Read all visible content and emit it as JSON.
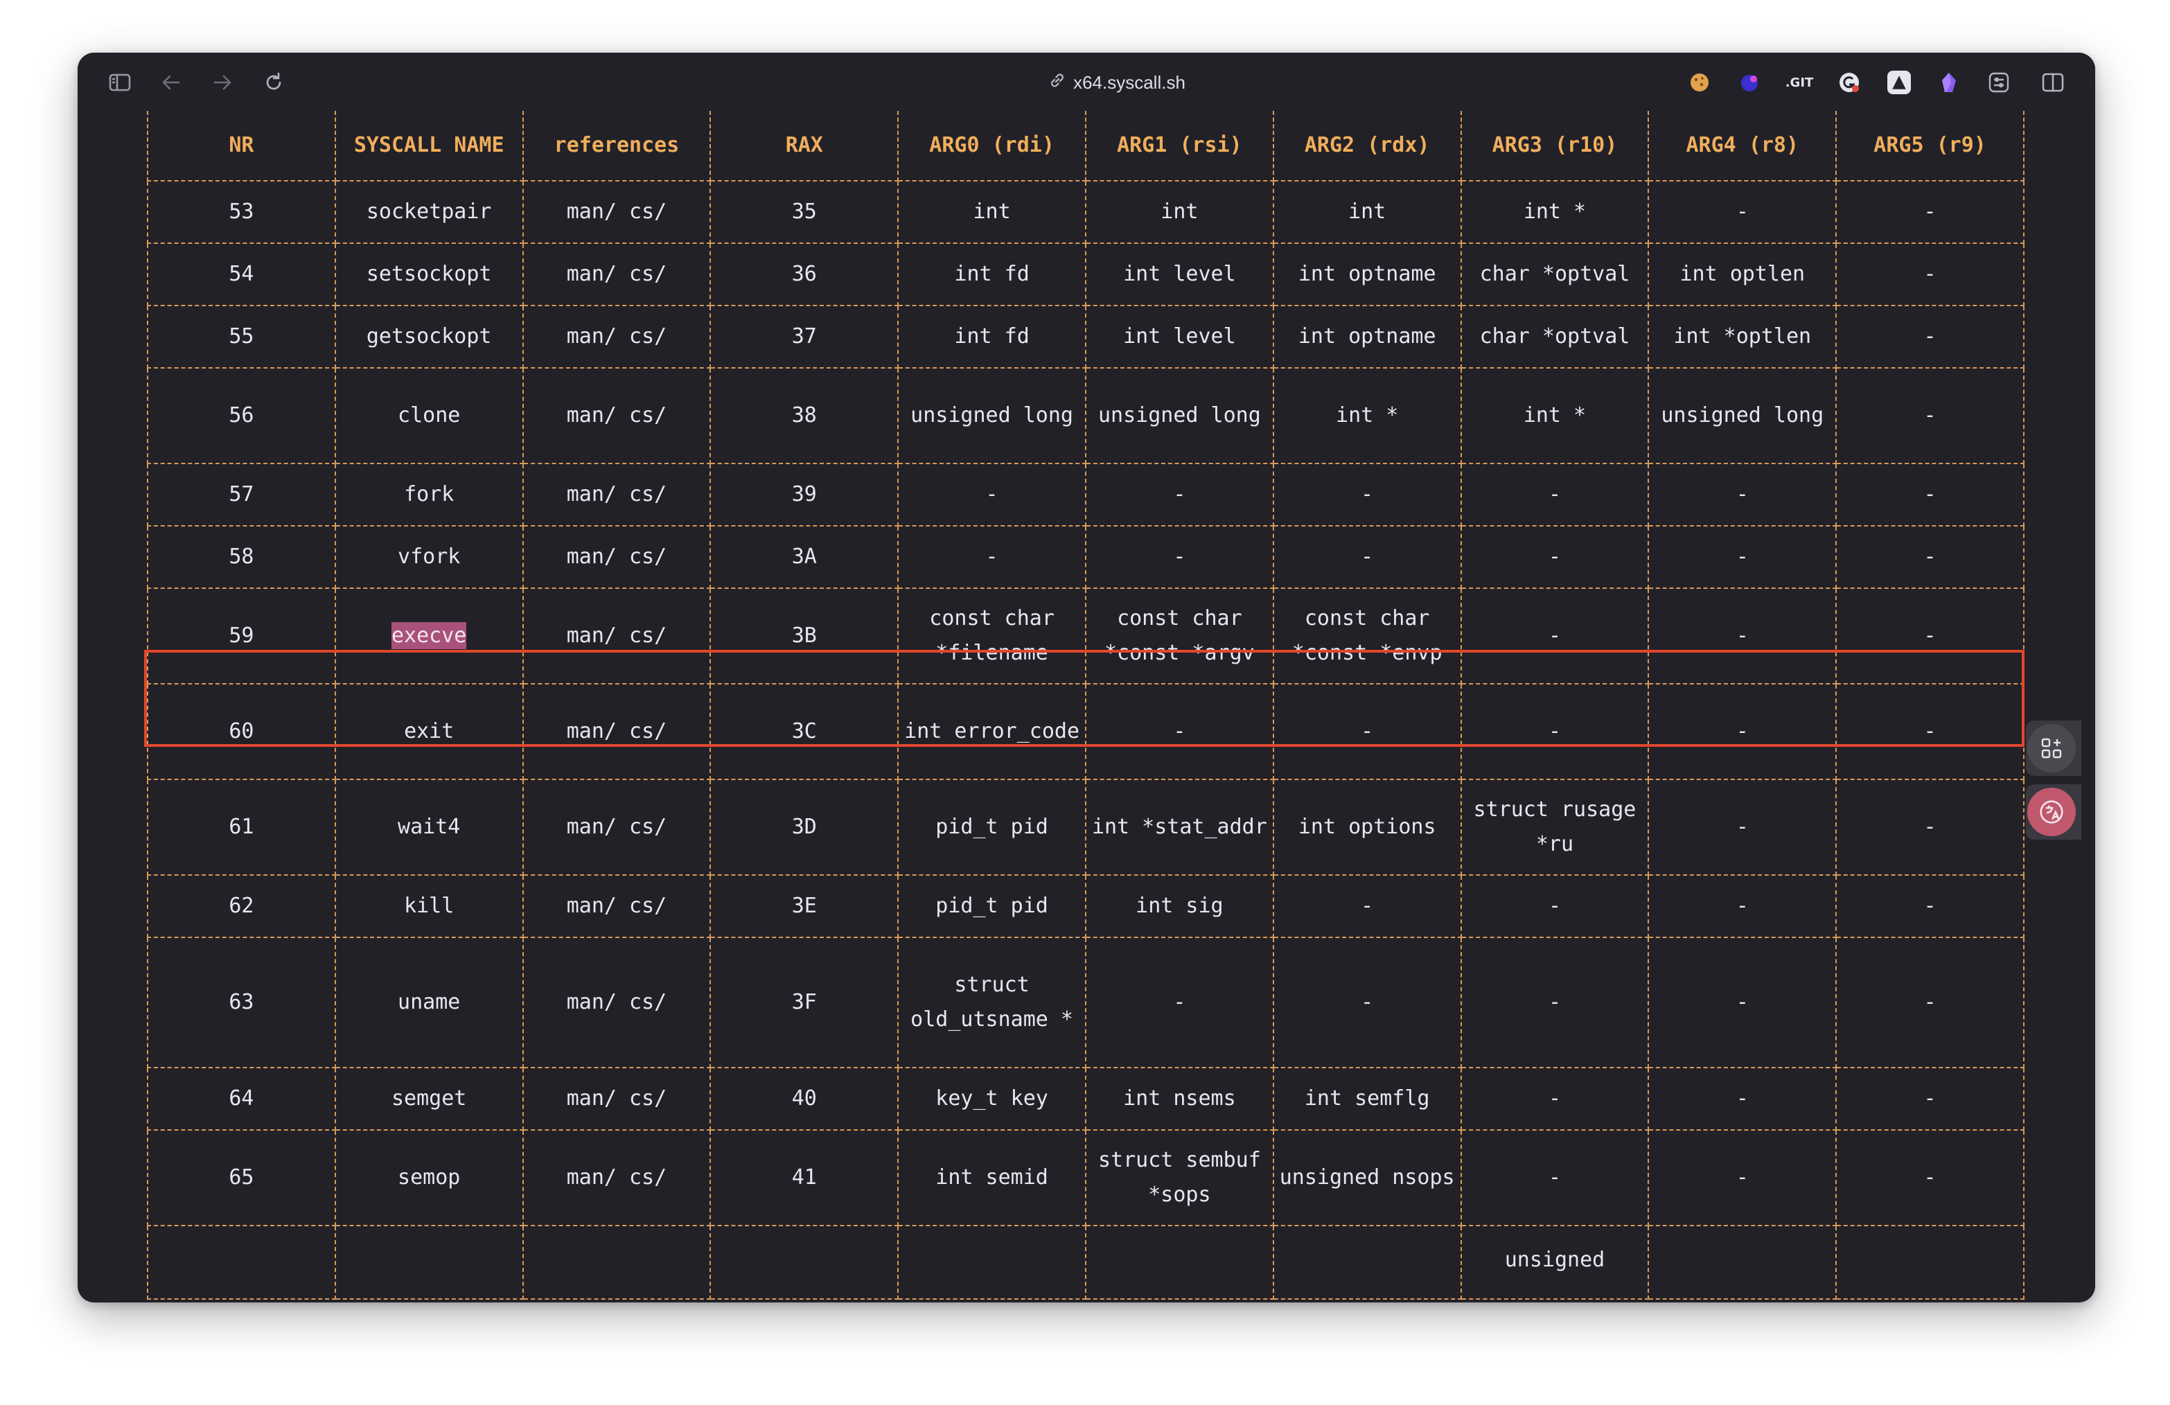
{
  "browser": {
    "url": "x64.syscall.sh",
    "icons": {
      "sidebar": "sidebar-toggle-icon",
      "back": "back-arrow-icon",
      "forward": "forward-arrow-icon",
      "reload": "reload-icon",
      "link": "link-icon",
      "split": "split-view-icon"
    },
    "extensions": [
      "cookie-extension-icon",
      "purple-extension-icon",
      "git-extension-icon",
      "grammarly-extension-icon",
      "proton-extension-icon",
      "obsidian-extension-icon",
      "extensions-menu-icon"
    ]
  },
  "table": {
    "headers": [
      "NR",
      "SYSCALL NAME",
      "references",
      "RAX",
      "ARG0 (rdi)",
      "ARG1 (rsi)",
      "ARG2 (rdx)",
      "ARG3 (r10)",
      "ARG4 (r8)",
      "ARG5 (r9)"
    ],
    "rows": [
      [
        "53",
        "socketpair",
        "man/ cs/",
        "35",
        "int",
        "int",
        "int",
        "int *",
        "-",
        "-"
      ],
      [
        "54",
        "setsockopt",
        "man/ cs/",
        "36",
        "int fd",
        "int level",
        "int optname",
        "char *optval",
        "int optlen",
        "-"
      ],
      [
        "55",
        "getsockopt",
        "man/ cs/",
        "37",
        "int fd",
        "int level",
        "int optname",
        "char *optval",
        "int *optlen",
        "-"
      ],
      [
        "56",
        "clone",
        "man/ cs/",
        "38",
        "unsigned long",
        "unsigned long",
        "int *",
        "int *",
        "unsigned long",
        "-"
      ],
      [
        "57",
        "fork",
        "man/ cs/",
        "39",
        "-",
        "-",
        "-",
        "-",
        "-",
        "-"
      ],
      [
        "58",
        "vfork",
        "man/ cs/",
        "3A",
        "-",
        "-",
        "-",
        "-",
        "-",
        "-"
      ],
      [
        "59",
        "execve",
        "man/ cs/",
        "3B",
        "const char *filename",
        "const char *const *argv",
        "const char *const *envp",
        "-",
        "-",
        "-"
      ],
      [
        "60",
        "exit",
        "man/ cs/",
        "3C",
        "int error_code",
        "-",
        "-",
        "-",
        "-",
        "-"
      ],
      [
        "61",
        "wait4",
        "man/ cs/",
        "3D",
        "pid_t pid",
        "int *stat_addr",
        "int options",
        "struct rusage *ru",
        "-",
        "-"
      ],
      [
        "62",
        "kill",
        "man/ cs/",
        "3E",
        "pid_t pid",
        "int sig",
        "-",
        "-",
        "-",
        "-"
      ],
      [
        "63",
        "uname",
        "man/ cs/",
        "3F",
        "struct old_utsname *",
        "-",
        "-",
        "-",
        "-",
        "-"
      ],
      [
        "64",
        "semget",
        "man/ cs/",
        "40",
        "key_t key",
        "int nsems",
        "int semflg",
        "-",
        "-",
        "-"
      ],
      [
        "65",
        "semop",
        "man/ cs/",
        "41",
        "int semid",
        "struct sembuf *sops",
        "unsigned nsops",
        "-",
        "-",
        "-"
      ],
      [
        "",
        "",
        "",
        "",
        "",
        "",
        "",
        "unsigned",
        "",
        ""
      ]
    ],
    "row_heights": [
      "single",
      "single",
      "single",
      "double",
      "single",
      "single",
      "double",
      "double",
      "double",
      "single",
      "triple",
      "single",
      "double",
      "cut"
    ],
    "highlighted_row_index": 6,
    "highlighted_text": "execve"
  },
  "floating": {
    "qr_button_icon": "qr-code-icon",
    "translate_button_icon": "translate-icon"
  }
}
